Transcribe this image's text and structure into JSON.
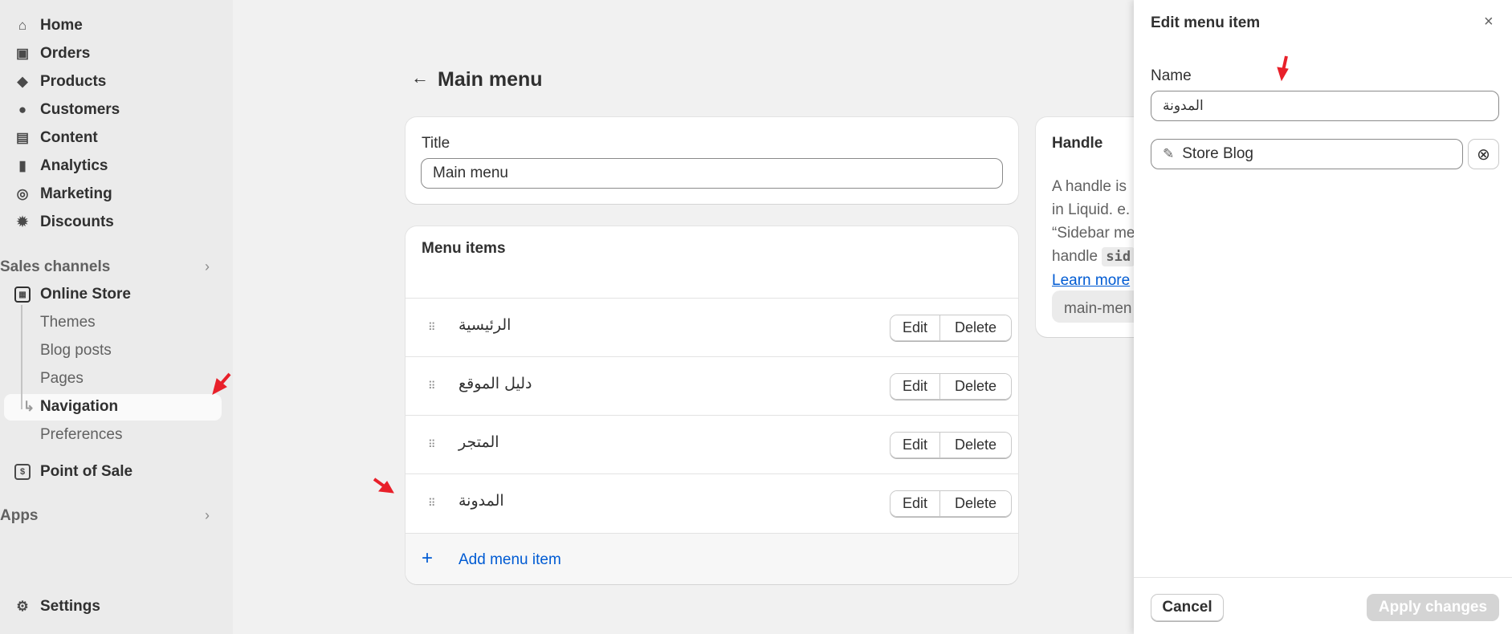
{
  "sidebar": {
    "items": [
      {
        "label": "Home",
        "icon": "home-icon",
        "glyph": "⌂"
      },
      {
        "label": "Orders",
        "icon": "inbox-icon",
        "glyph": "▣"
      },
      {
        "label": "Products",
        "icon": "tag-icon",
        "glyph": "◆"
      },
      {
        "label": "Customers",
        "icon": "person-icon",
        "glyph": "●"
      },
      {
        "label": "Content",
        "icon": "image-icon",
        "glyph": "▤"
      },
      {
        "label": "Analytics",
        "icon": "bar-chart-icon",
        "glyph": "▮"
      },
      {
        "label": "Marketing",
        "icon": "target-icon",
        "glyph": "◎"
      },
      {
        "label": "Discounts",
        "icon": "discount-icon",
        "glyph": "✹"
      }
    ],
    "sales_channels": "Sales channels",
    "online_store": "Online Store",
    "sub_items": [
      "Themes",
      "Blog posts",
      "Pages",
      "Navigation",
      "Preferences"
    ],
    "point_of_sale": "Point of Sale",
    "apps": "Apps",
    "settings": "Settings"
  },
  "page": {
    "title": "Main menu"
  },
  "title_card": {
    "label": "Title",
    "value": "Main menu"
  },
  "menu_card": {
    "heading": "Menu items",
    "items": [
      "الرئيسية",
      "دليل الموقع",
      "المتجر",
      "المدونة"
    ],
    "edit": "Edit",
    "delete": "Delete",
    "add": "Add menu item"
  },
  "handle_card": {
    "heading": "Handle",
    "lines": [
      "A handle is",
      "in Liquid. e.",
      "“Sidebar me",
      "handle "
    ],
    "code": "sid",
    "learn_more": "Learn more",
    "value": "main-men"
  },
  "panel": {
    "title": "Edit menu item",
    "name_label": "Name",
    "name_value": "المدونة",
    "link_value": "Store Blog",
    "cancel": "Cancel",
    "apply": "Apply changes"
  },
  "colors": {
    "accent": "#005bd3",
    "annotation_arrow": "#e8202a"
  }
}
